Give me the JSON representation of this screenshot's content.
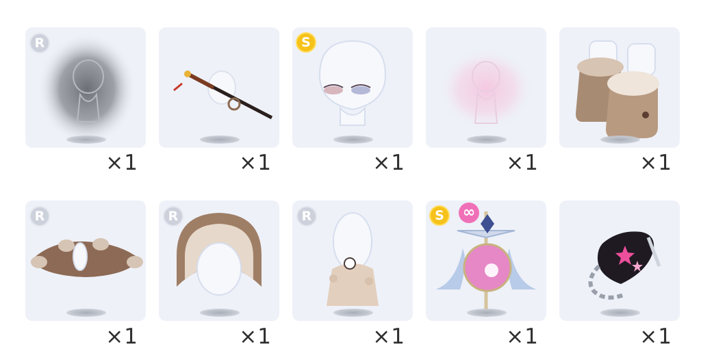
{
  "items": [
    {
      "name": "grey smoke aura",
      "badge": "R",
      "quantity": "×1"
    },
    {
      "name": "katana sword",
      "badge": "",
      "quantity": "×1"
    },
    {
      "name": "sleepy eyes",
      "badge": "S",
      "quantity": "×1"
    },
    {
      "name": "pink glow aura",
      "badge": "",
      "quantity": "×1"
    },
    {
      "name": "fur boots",
      "badge": "",
      "quantity": "×1"
    },
    {
      "name": "fur rug",
      "badge": "R",
      "quantity": "×1"
    },
    {
      "name": "fur hood",
      "badge": "R",
      "quantity": "×1"
    },
    {
      "name": "fur coat",
      "badge": "R",
      "quantity": "×1"
    },
    {
      "name": "crystal orb staff",
      "badge": "S",
      "badge2": "∞",
      "quantity": "×1"
    },
    {
      "name": "black guitar pick necklace",
      "badge": "",
      "quantity": "×1"
    }
  ],
  "colors": {
    "card_bg": "#eef1f8",
    "badge_r": "#cdd1db",
    "badge_s": "#f6c21a",
    "badge_infinity": "#f070b7"
  }
}
